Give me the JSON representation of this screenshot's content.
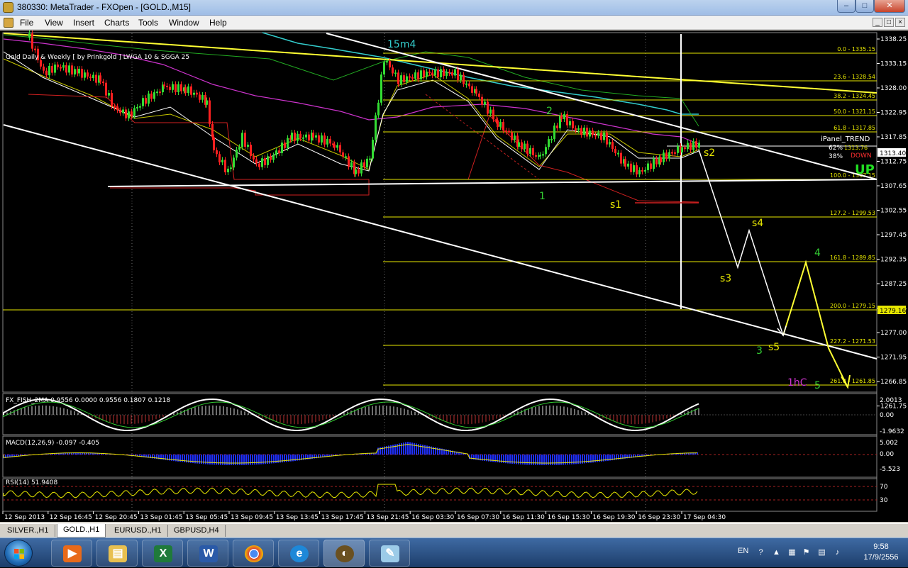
{
  "window": {
    "title": "380330: MetaTrader - FXOpen - [GOLD.,M15]",
    "min_glyph": "–",
    "max_glyph": "□",
    "close_glyph": "✕"
  },
  "menu": {
    "items": [
      "File",
      "View",
      "Insert",
      "Charts",
      "Tools",
      "Window",
      "Help"
    ],
    "mdi_min": "_",
    "mdi_restore": "□",
    "mdi_close": "×"
  },
  "chart": {
    "indicator_label": "Gold Daily & Weekly [ by Prinkgold ]  LWGA 10  &  SGGA 25",
    "wave_label_main": "15m4",
    "price_scale": [
      "1338.25",
      "1333.15",
      "1328.00",
      "1322.95",
      "1317.85",
      "1312.75",
      "1307.65",
      "1302.55",
      "1297.45",
      "1292.35",
      "1287.25",
      "1282.15",
      "1277.00",
      "1271.95",
      "1266.85",
      "1261.75"
    ],
    "current_price": "1313.40",
    "marked_price": "1279.16",
    "fib_levels": [
      "0.0 - 1335.15",
      "23.6 - 1328.54",
      "38.2 - 1324.45",
      "50.0 - 1321.15",
      "61.8 - 1317.85",
      "100.0 - 1307.15",
      "127.2 - 1299.53",
      "161.8 - 1289.85",
      "200.0 - 1279.15",
      "227.2 - 1271.53",
      "261.8 - 1261.85"
    ],
    "fib_short": {
      "a": "62%",
      "b": "38%",
      "val": "1313.76"
    },
    "ipanel": {
      "title": "iPanel_TREND",
      "state": "DOWN",
      "direction": "UP"
    },
    "wave_labels": [
      "1",
      "2",
      "s1",
      "s2",
      "s3",
      "s4",
      "s5",
      "3",
      "4",
      "5",
      "1hC"
    ],
    "time_scale": [
      "12 Sep 2013",
      "12 Sep 16:45",
      "12 Sep 20:45",
      "13 Sep 01:45",
      "13 Sep 05:45",
      "13 Sep 09:45",
      "13 Sep 13:45",
      "13 Sep 17:45",
      "13 Sep 21:45",
      "16 Sep 03:30",
      "16 Sep 07:30",
      "16 Sep 11:30",
      "16 Sep 15:30",
      "16 Sep 19:30",
      "16 Sep 23:30",
      "17 Sep 04:30"
    ]
  },
  "fisher": {
    "label": "FX_FISH_2MA 0.9556 0.0000 0.9556 0.1807 0.1218",
    "scale": [
      "2.0013",
      "0.00",
      "-1.9632"
    ]
  },
  "macd": {
    "label": "MACD(12,26,9) -0.097 -0.405",
    "scale": [
      "5.002",
      "0.00",
      "-5.523"
    ]
  },
  "rsi": {
    "label": "RSI(14) 51.9408",
    "scale": [
      "70",
      "30"
    ]
  },
  "tabs": [
    "SILVER.,H1",
    "GOLD.,H1",
    "EURUSD.,H1",
    "GBPUSD,H4"
  ],
  "active_tab": "GOLD.,H1",
  "taskbar": {
    "apps": [
      "media-player",
      "file-explorer",
      "excel",
      "word",
      "chrome",
      "internet-explorer",
      "metatrader",
      "paint"
    ],
    "lang": "EN",
    "time": "9:58",
    "date": "17/9/2556"
  },
  "colors": {
    "chart_bg": "#000000",
    "grid": "#808080",
    "bull_candle": "#33dd33",
    "bear_candle": "#ff2020",
    "fib": "#e8e800",
    "trend_line": "#ffffff",
    "yellow_trend": "#ffff33",
    "wave_green": "#33cc33",
    "wave_yellow": "#e8e800",
    "purple": "#cc33cc"
  }
}
